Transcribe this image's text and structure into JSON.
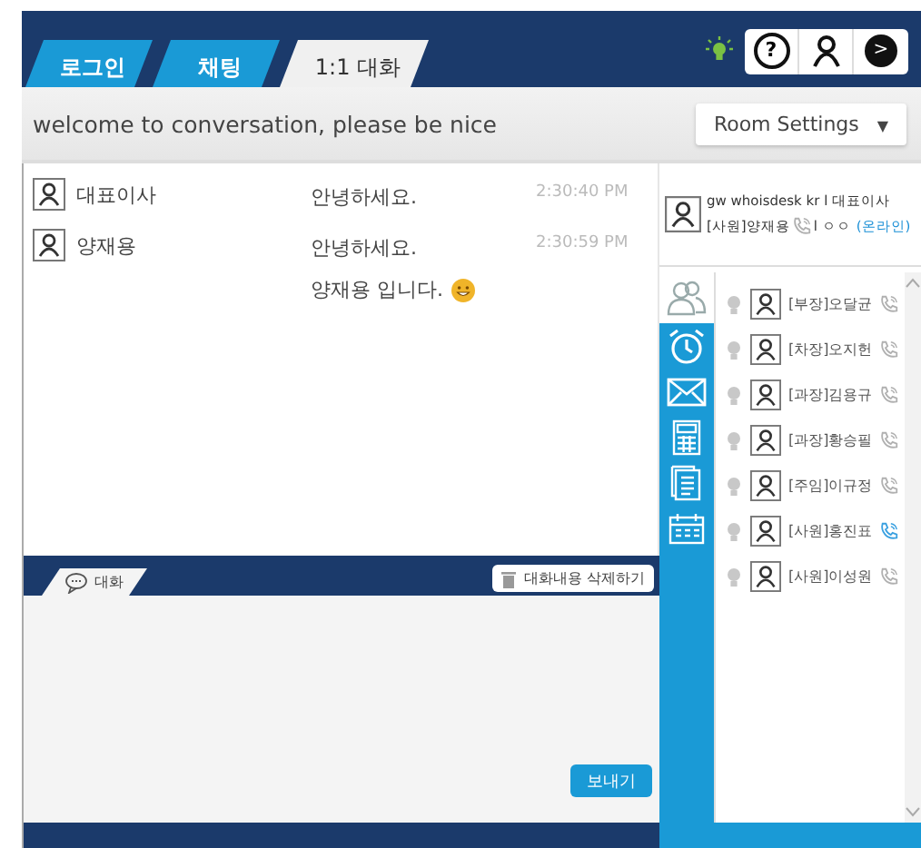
{
  "tabs": [
    {
      "label": "로그인",
      "selected": false
    },
    {
      "label": "채팅",
      "selected": false
    },
    {
      "label": "1:1 대화",
      "selected": true
    }
  ],
  "status_lamp": {
    "on": true
  },
  "toolbar": [
    "?",
    ">"
  ],
  "topic": "welcome to conversation, please be nice",
  "room_settings": {
    "label": "Room Settings",
    "caret": "▼"
  },
  "messages": [
    {
      "sender": "대표이사",
      "lines": [
        "안녕하세요."
      ],
      "time": "2:30:40 PM",
      "emoji": false
    },
    {
      "sender": "양재용",
      "lines": [
        "안녕하세요.",
        "양재용 입니다."
      ],
      "time": "2:30:59 PM",
      "emoji": true
    }
  ],
  "compose": {
    "tab": "대화",
    "clear_button": "대화내용 삭제하기",
    "send_button": "보내기"
  },
  "profile": {
    "line_1": "gw whoisdesk kr l 대표이사",
    "name": "[사원]양재용",
    "extra": "l ㅇㅇ",
    "status": "(온라인)"
  },
  "sidebar": [
    {
      "kind": "people",
      "selected": true
    },
    {
      "kind": "alarm",
      "selected": false
    },
    {
      "kind": "mail",
      "selected": false
    },
    {
      "kind": "calculator",
      "selected": false
    },
    {
      "kind": "memo",
      "selected": false
    },
    {
      "kind": "calendar",
      "selected": false
    }
  ],
  "contacts": [
    {
      "name": "[부장]오달균",
      "lamp_on": false,
      "phone_on": false
    },
    {
      "name": "[차장]오지헌",
      "lamp_on": false,
      "phone_on": false
    },
    {
      "name": "[과장]김용규",
      "lamp_on": false,
      "phone_on": false
    },
    {
      "name": "[과장]황승필",
      "lamp_on": false,
      "phone_on": false
    },
    {
      "name": "[주임]이규정",
      "lamp_on": false,
      "phone_on": false
    },
    {
      "name": "[사원]홍진표",
      "lamp_on": false,
      "phone_on": true
    },
    {
      "name": "[사원]이성원",
      "lamp_on": false,
      "phone_on": false
    }
  ]
}
